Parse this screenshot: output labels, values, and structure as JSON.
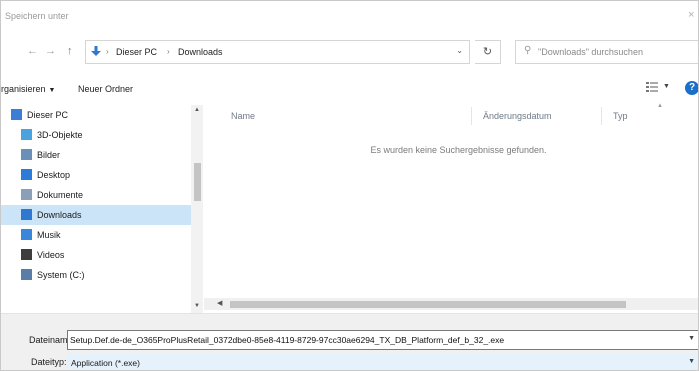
{
  "window": {
    "title": "Speichern unter",
    "close_glyph": "×"
  },
  "address_bar": {
    "crumbs": [
      "Dieser PC",
      "Downloads"
    ],
    "separator": "›",
    "refresh_glyph": "↻",
    "search_placeholder": "\"Downloads\" durchsuchen"
  },
  "toolbar": {
    "organize_label": "rganisieren",
    "new_folder_label": "Neuer Ordner",
    "help_glyph": "?"
  },
  "sidebar": {
    "items": [
      {
        "label": "Dieser PC",
        "icon": "computer-icon",
        "color": "#3a7fd5",
        "selected": false
      },
      {
        "label": "3D-Objekte",
        "icon": "3d-objects-icon",
        "color": "#4aa3df",
        "selected": false
      },
      {
        "label": "Bilder",
        "icon": "pictures-icon",
        "color": "#6a8fb8",
        "selected": false
      },
      {
        "label": "Desktop",
        "icon": "desktop-icon",
        "color": "#2d7bd8",
        "selected": false
      },
      {
        "label": "Dokumente",
        "icon": "documents-icon",
        "color": "#8aa0b8",
        "selected": false
      },
      {
        "label": "Downloads",
        "icon": "downloads-icon",
        "color": "#2f78d0",
        "selected": true
      },
      {
        "label": "Musik",
        "icon": "music-icon",
        "color": "#3a86d8",
        "selected": false
      },
      {
        "label": "Videos",
        "icon": "videos-icon",
        "color": "#3d3d3d",
        "selected": false
      },
      {
        "label": "System (C:)",
        "icon": "drive-icon",
        "color": "#5a7da8",
        "selected": false
      }
    ]
  },
  "file_list": {
    "columns": [
      "Name",
      "Änderungsdatum",
      "Typ"
    ],
    "empty_message": "Es wurden keine Suchergebnisse gefunden."
  },
  "footer": {
    "filename_label": "Dateiname:",
    "filename_value": "Setup.Def.de-de_O365ProPlusRetail_0372dbe0-85e8-4119-8729-97cc30ae6294_TX_DB_Platform_def_b_32_.exe",
    "filetype_label": "Dateityp:",
    "filetype_value": "Application (*.exe)"
  },
  "colors": {
    "selection": "#cce4f7",
    "accent": "#1a6fc9",
    "filetype_bg": "#e5f1fb"
  }
}
